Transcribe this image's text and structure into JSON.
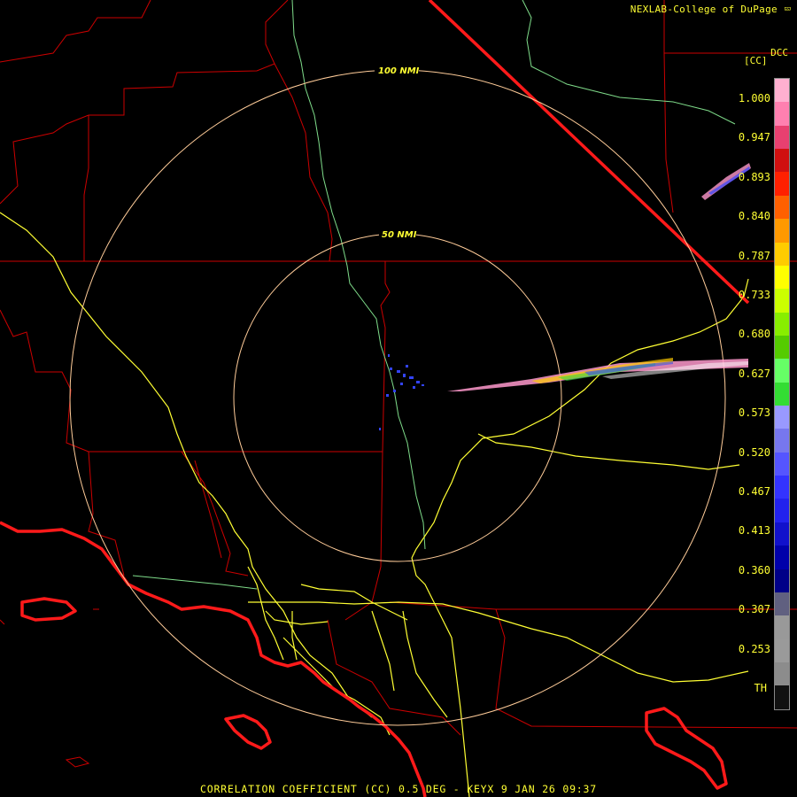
{
  "header": {
    "credit": "NEXLAB-College of DuPage",
    "credit_logo_icon": "nexlab-logo-icon",
    "site": "DCC"
  },
  "rings": {
    "outer_label": "100 NMI",
    "inner_label": "50 NMI"
  },
  "colorbar": {
    "label": "[CC]",
    "ticks": [
      "1.000",
      "0.947",
      "0.893",
      "0.840",
      "0.787",
      "0.733",
      "0.680",
      "0.627",
      "0.573",
      "0.520",
      "0.467",
      "0.413",
      "0.360",
      "0.307",
      "0.253",
      "TH"
    ],
    "colors": [
      "#ffb0d0",
      "#ff80b0",
      "#e84070",
      "#d01010",
      "#ff2000",
      "#ff6000",
      "#ff9900",
      "#ffcc00",
      "#ffff00",
      "#ccff00",
      "#88ee00",
      "#55cc00",
      "#66ff66",
      "#33dd33",
      "#9999ff",
      "#7777ee",
      "#5555ff",
      "#3333ff",
      "#2222ee",
      "#1111cc",
      "#0000aa",
      "#000088",
      "#606080",
      "#999999",
      "#9a9a9a",
      "#8c8c8c",
      "#111111"
    ]
  },
  "map_colors": {
    "state_lines": "#cc0000",
    "coast": "#ff1a1a",
    "rivers": "#7fdc8a",
    "highways": "#ffff33",
    "rings": "#ffcc99"
  },
  "footer": {
    "product": "CORRELATION COEFFICIENT (CC) 0.5 DEG - KEYX 9 JAN 26 09:37"
  }
}
